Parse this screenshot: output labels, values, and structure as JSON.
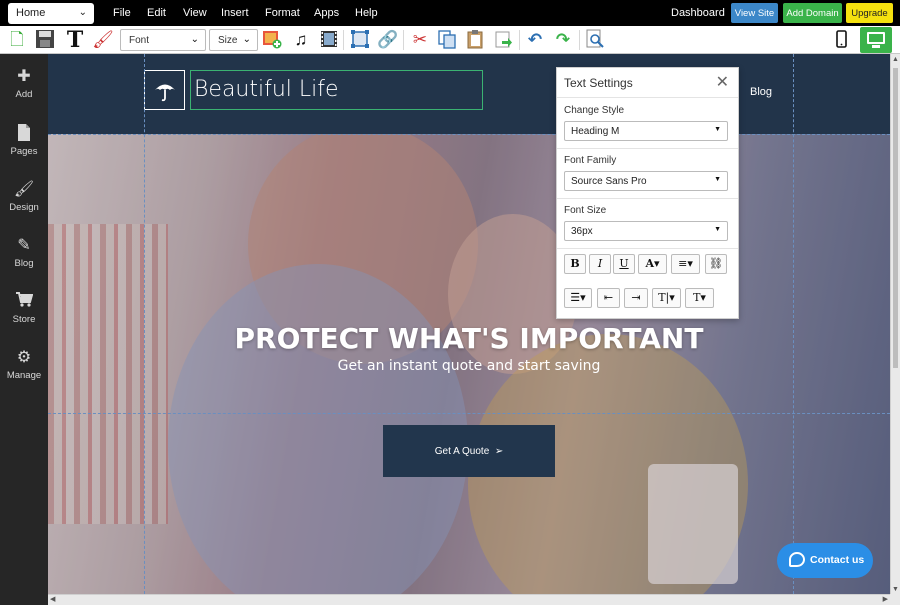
{
  "menubar": {
    "page_select": "Home",
    "menus": [
      "File",
      "Edit",
      "View",
      "Insert",
      "Format",
      "Apps",
      "Help"
    ],
    "dashboard": "Dashboard",
    "view_site": "View Site",
    "add_domain": "Add Domain",
    "upgrade": "Upgrade",
    "colors": {
      "view_site": "#3c87c8",
      "add_domain": "#3ab34a",
      "upgrade": "#f5e10f"
    }
  },
  "toolbar": {
    "font_select": "Font",
    "size_select": "Size",
    "icons": [
      "new-page-icon",
      "save-icon",
      "text-icon",
      "format-paint-icon",
      "image-icon",
      "music-icon",
      "video-icon",
      "frame-icon",
      "link-icon",
      "cut-icon",
      "copy-icon",
      "paste-icon",
      "paste-special-icon",
      "undo-icon",
      "redo-icon",
      "preview-icon",
      "mobile-view-icon",
      "desktop-view-icon"
    ]
  },
  "sidebar": {
    "items": [
      {
        "label": "Add",
        "icon": "plus-icon"
      },
      {
        "label": "Pages",
        "icon": "page-icon"
      },
      {
        "label": "Design",
        "icon": "brush-icon"
      },
      {
        "label": "Blog",
        "icon": "pencil-icon"
      },
      {
        "label": "Store",
        "icon": "cart-icon"
      },
      {
        "label": "Manage",
        "icon": "gear-icon"
      }
    ]
  },
  "site": {
    "title": "Beautiful Life",
    "nav_blog": "Blog",
    "hero_title": "PROTECT WHAT'S IMPORTANT",
    "hero_subtitle": "Get an instant quote and start saving",
    "cta": "Get A Quote",
    "contact": "Contact us",
    "colors": {
      "header": "#22344a",
      "cta": "#22364d",
      "contact": "#2b8ee6",
      "selection": "#3bb272"
    }
  },
  "text_settings": {
    "title": "Text Settings",
    "style_label": "Change Style",
    "style_value": "Heading M",
    "family_label": "Font Family",
    "family_value": "Source Sans Pro",
    "size_label": "Font Size",
    "size_value": "36px",
    "format_buttons": [
      "B",
      "I",
      "U",
      "A▾",
      "≡▾",
      "⛓"
    ],
    "list_buttons": [
      "☰▾",
      "⇤",
      "⇥",
      "T|▾",
      "T▾"
    ]
  }
}
